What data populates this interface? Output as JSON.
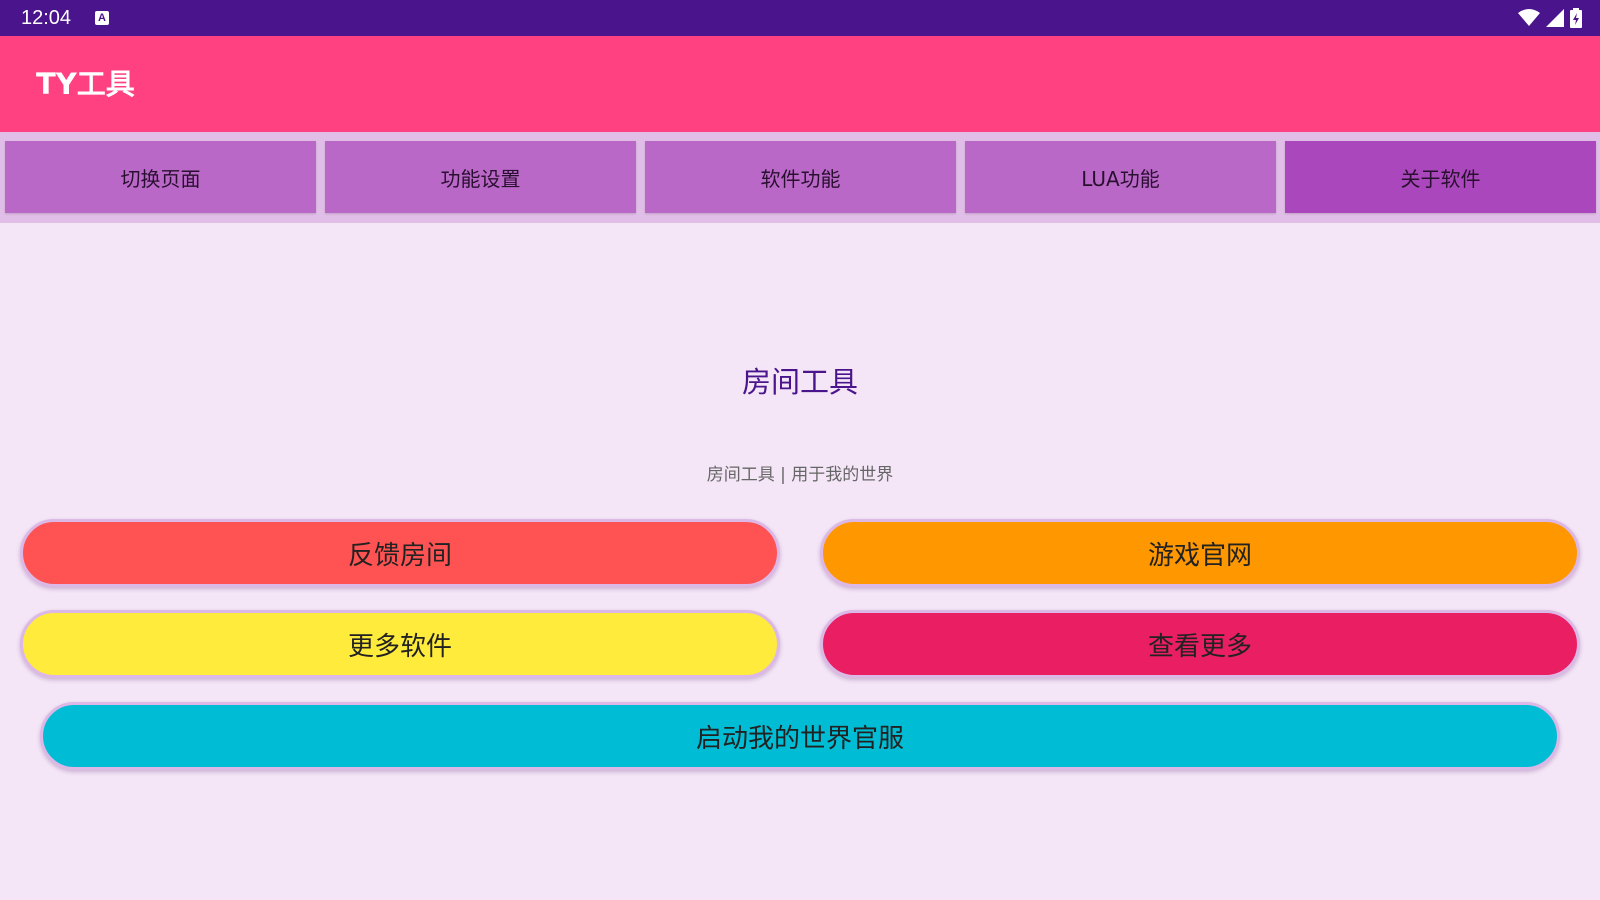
{
  "status_bar": {
    "time": "12:04",
    "notification_icon": "a-icon",
    "icons": [
      "wifi-icon",
      "signal-icon",
      "battery-icon"
    ]
  },
  "app_bar": {
    "title": "TY工具",
    "color": "#ff4081"
  },
  "tabs": [
    {
      "label": "切换页面",
      "active": false
    },
    {
      "label": "功能设置",
      "active": false
    },
    {
      "label": "软件功能",
      "active": false
    },
    {
      "label": "LUA功能",
      "active": false
    },
    {
      "label": "关于软件",
      "active": true
    }
  ],
  "main": {
    "title": "房间工具",
    "subtitle": "房间工具 | 用于我的世界",
    "buttons": [
      {
        "label": "反馈房间",
        "color": "#ff5252"
      },
      {
        "label": "游戏官网",
        "color": "#ff9800"
      },
      {
        "label": "更多软件",
        "color": "#ffeb3b"
      },
      {
        "label": "查看更多",
        "color": "#e91e63"
      },
      {
        "label": "启动我的世界官服",
        "color": "#00bcd4"
      }
    ]
  }
}
